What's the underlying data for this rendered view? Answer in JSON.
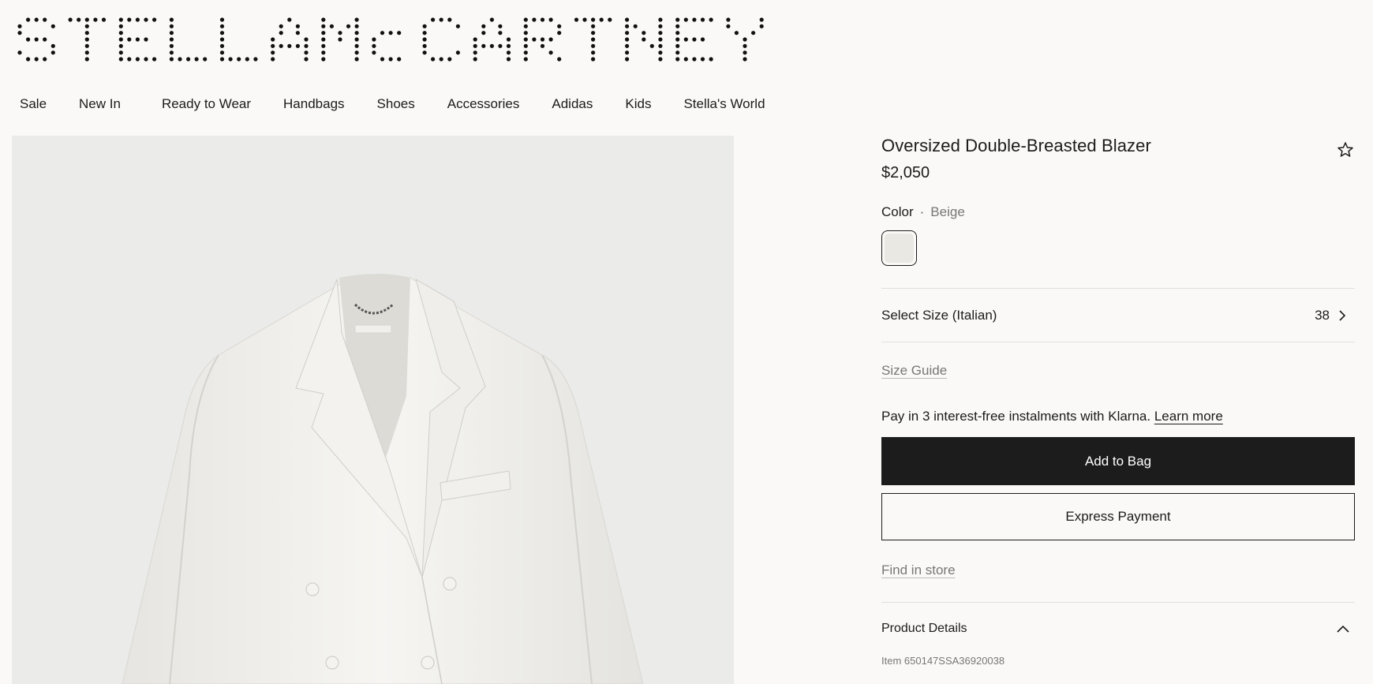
{
  "brand": {
    "logo_text": "STELLA McCARTNEY"
  },
  "nav": {
    "items": [
      "Sale",
      "New In",
      "Ready to Wear",
      "Handbags",
      "Shoes",
      "Accessories",
      "Adidas",
      "Kids",
      "Stella's World"
    ]
  },
  "product": {
    "title": "Oversized Double-Breasted Blazer",
    "price": "$2,050",
    "favorite_icon": "star-outline-icon",
    "color_label": "Color",
    "color_separator": "·",
    "color_value": "Beige",
    "swatch_color": "#e9e8e3",
    "size_label": "Select Size (Italian)",
    "size_value": "38",
    "size_guide": "Size Guide",
    "klarna_text": "Pay in 3 interest-free instalments with Klarna.",
    "klarna_link": "Learn more",
    "add_to_bag": "Add to Bag",
    "express_payment": "Express Payment",
    "find_in_store": "Find in store",
    "details_label": "Product Details",
    "item_number": "Item 650147SSA36920038"
  },
  "colors": {
    "background": "#faf9f7",
    "image_background": "#ebebea",
    "primary_button": "#1c1c1c",
    "text_muted": "#777777"
  }
}
